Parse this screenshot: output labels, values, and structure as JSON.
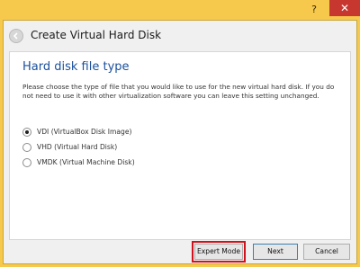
{
  "window": {
    "help_label": "?",
    "close_label": "✕"
  },
  "header": {
    "title": "Create Virtual Hard Disk"
  },
  "page": {
    "section_title": "Hard disk file type",
    "description": "Please choose the type of file that you would like to use for the new virtual hard disk. If you do not need to use it with other virtualization software you can leave this setting unchanged."
  },
  "options": [
    {
      "label": "VDI (VirtualBox Disk Image)",
      "selected": true
    },
    {
      "label": "VHD (Virtual Hard Disk)",
      "selected": false
    },
    {
      "label": "VMDK (Virtual Machine Disk)",
      "selected": false
    }
  ],
  "buttons": {
    "expert": "Expert Mode",
    "next": "Next",
    "cancel": "Cancel"
  },
  "colors": {
    "title_bar": "#f6c84b",
    "close": "#c7372f",
    "section_title": "#1a4f9c",
    "highlight": "#d1121c"
  },
  "icons": {
    "back": "back-arrow-icon",
    "close": "close-icon",
    "help": "help-icon"
  }
}
